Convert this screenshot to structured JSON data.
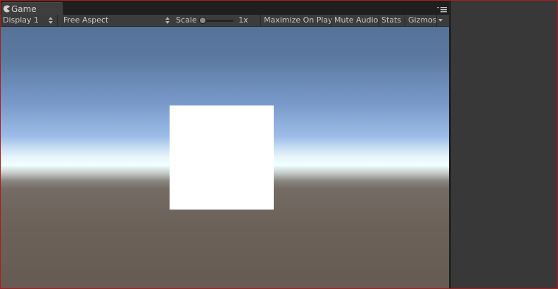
{
  "tab": {
    "title": "Game",
    "icon": "pacman-icon"
  },
  "toolbar": {
    "display": "Display 1",
    "aspect": "Free Aspect",
    "scale_label": "Scale",
    "scale_value": "1x",
    "scale_level": 0,
    "maximize": "Maximize On Play",
    "mute": "Mute Audio",
    "stats": "Stats",
    "gizmos": "Gizmos"
  },
  "colors": {
    "frame_border": "#b11a1a",
    "toolbar_bg": "#3c3c3c",
    "sky_top": "#567397",
    "horizon": "#f0ffff",
    "ground": "#6c625a",
    "object": "#ffffff"
  }
}
